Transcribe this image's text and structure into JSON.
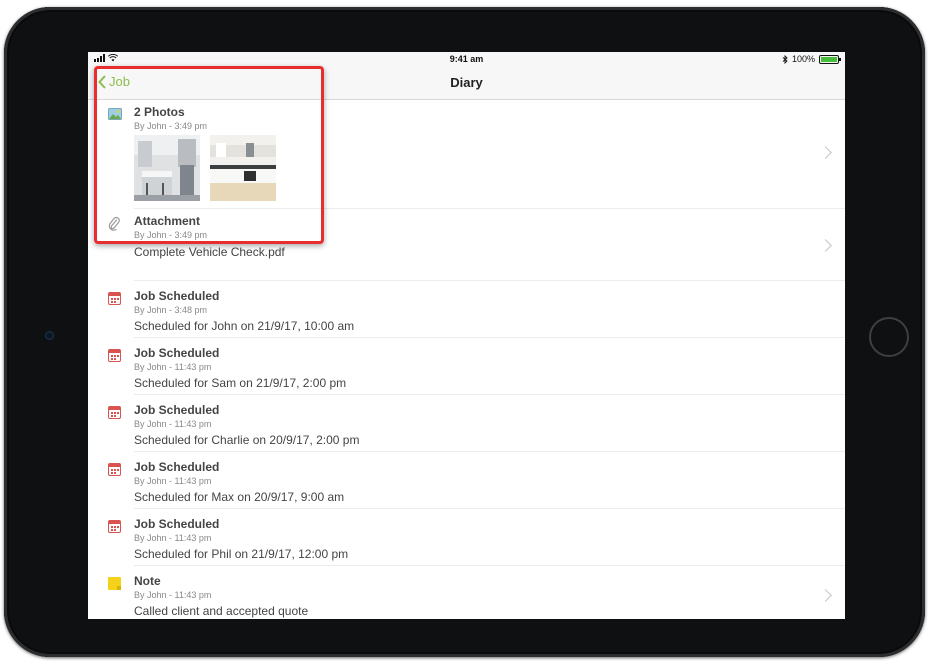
{
  "status_bar": {
    "time": "9:41 am",
    "battery_percent": "100%",
    "battery_level": 1.0
  },
  "nav": {
    "back_label": "Job",
    "title": "Diary"
  },
  "entries": [
    {
      "title": "2 Photos",
      "by": "By John - 3:49 pm",
      "desc": "",
      "icon": "photo-icon"
    },
    {
      "title": "Attachment",
      "by": "By John - 3:49 pm",
      "desc": "Complete Vehicle Check.pdf",
      "icon": "paperclip-icon"
    },
    {
      "title": "Job Scheduled",
      "by": "By John - 3:48 pm",
      "desc": "Scheduled for John on 21/9/17, 10:00 am",
      "icon": "calendar-icon"
    },
    {
      "title": "Job Scheduled",
      "by": "By John - 11:43 pm",
      "desc": "Scheduled for Sam on 21/9/17, 2:00 pm",
      "icon": "calendar-icon"
    },
    {
      "title": "Job Scheduled",
      "by": "By John - 11:43 pm",
      "desc": "Scheduled for Charlie on 20/9/17, 2:00 pm",
      "icon": "calendar-icon"
    },
    {
      "title": "Job Scheduled",
      "by": "By John - 11:43 pm",
      "desc": "Scheduled for Max on 20/9/17, 9:00 am",
      "icon": "calendar-icon"
    },
    {
      "title": "Job Scheduled",
      "by": "By John - 11:43 pm",
      "desc": "Scheduled for Phil on 21/9/17, 12:00 pm",
      "icon": "calendar-icon"
    },
    {
      "title": "Note",
      "by": "By John - 11:43 pm",
      "desc": "Called client and accepted quote",
      "icon": "note-icon"
    }
  ],
  "colors": {
    "accent": "#8bbf4a",
    "calendar": "#d9534f",
    "note": "#f5d21a",
    "highlight": "#e62e2e"
  }
}
